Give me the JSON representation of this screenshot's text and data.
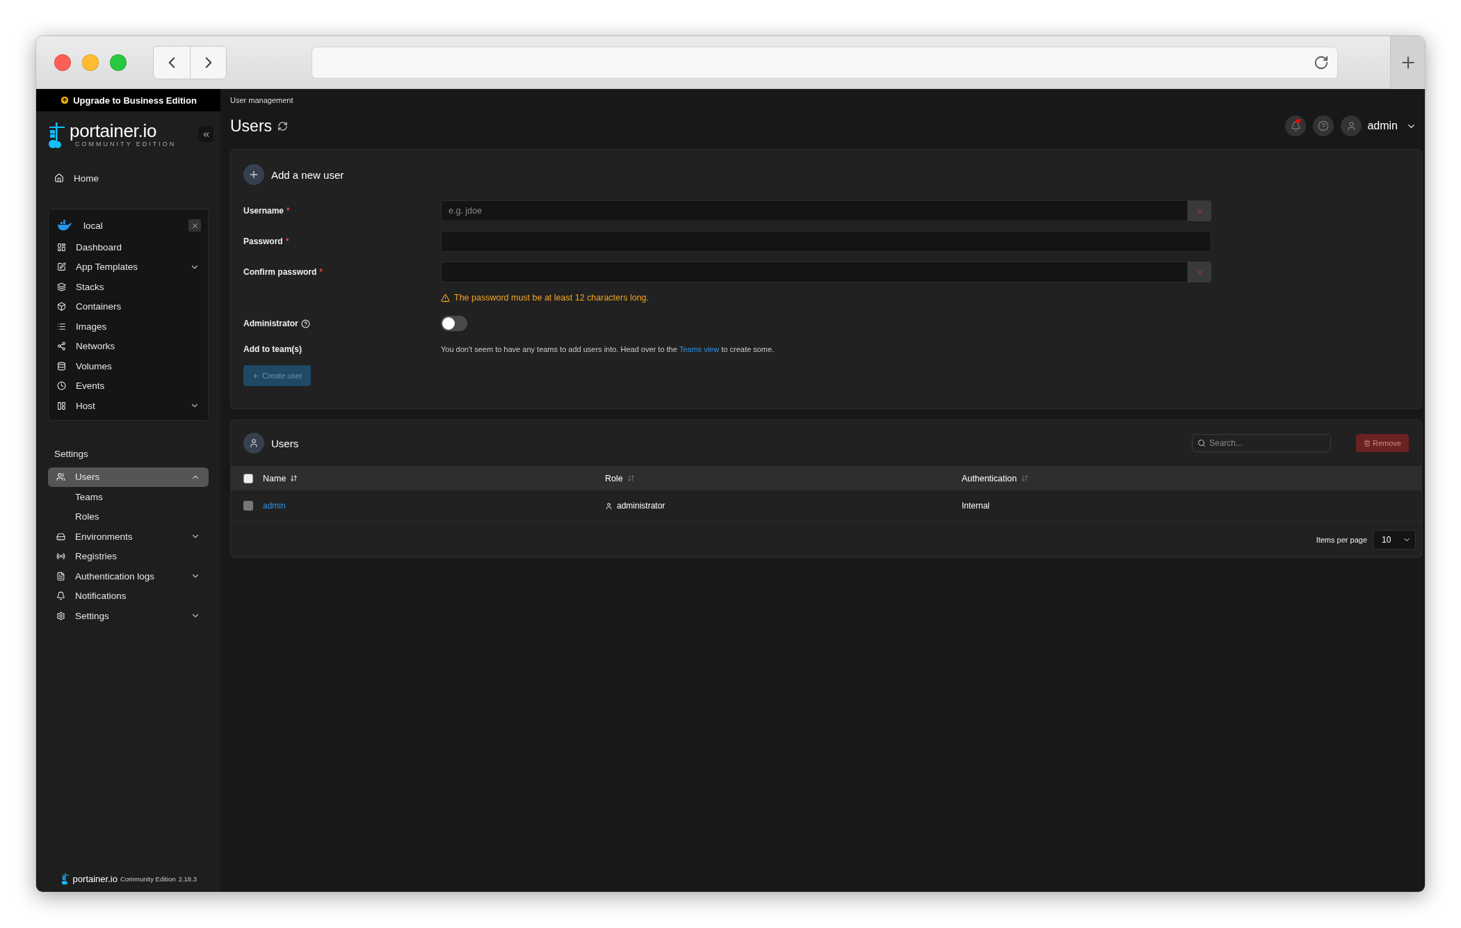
{
  "sidebar": {
    "upgrade_banner": "Upgrade to Business Edition",
    "logo": {
      "name": "portainer.io",
      "edition": "COMMUNITY EDITION"
    },
    "home": "Home",
    "environment": {
      "name": "local",
      "items": [
        {
          "label": "Dashboard"
        },
        {
          "label": "App Templates",
          "expanded": false
        },
        {
          "label": "Stacks"
        },
        {
          "label": "Containers"
        },
        {
          "label": "Images"
        },
        {
          "label": "Networks"
        },
        {
          "label": "Volumes"
        },
        {
          "label": "Events"
        },
        {
          "label": "Host",
          "expanded": false
        }
      ]
    },
    "settings_heading": "Settings",
    "settings_items": [
      {
        "label": "Users",
        "selected": true,
        "expanded": true,
        "children": [
          {
            "label": "Teams"
          },
          {
            "label": "Roles"
          }
        ]
      },
      {
        "label": "Environments",
        "selected": false,
        "expanded": false
      },
      {
        "label": "Registries",
        "selected": false
      },
      {
        "label": "Authentication logs",
        "selected": false,
        "expanded": false
      },
      {
        "label": "Notifications",
        "selected": false
      },
      {
        "label": "Settings",
        "selected": false,
        "expanded": false
      }
    ],
    "footer": {
      "brand": "portainer.io",
      "edition": "Community Edition",
      "version": "2.18.3"
    }
  },
  "header": {
    "breadcrumb": "User management",
    "title": "Users",
    "notifications": {
      "unread": true
    },
    "user": "admin"
  },
  "form": {
    "title": "Add a new user",
    "fields": [
      {
        "label": "Username",
        "required_mark": "*",
        "placeholder": "e.g. jdoe",
        "invalid": true
      },
      {
        "label": "Password",
        "required_mark": "*",
        "invalid": false
      },
      {
        "label": "Confirm password",
        "required_mark": "*",
        "invalid": true
      }
    ],
    "warning": "The password must be at least 12 characters long.",
    "administrator": {
      "label": "Administrator",
      "on": false
    },
    "teams": {
      "label": "Add to team(s)",
      "text_before": "You don't seem to have any teams to add users into. Head over to the",
      "link": "Teams view",
      "text_after": "to create some."
    },
    "create_button": {
      "label": "Create user",
      "disabled": true
    }
  },
  "table": {
    "title": "Users",
    "search": {
      "placeholder": "Search..."
    },
    "remove_button": {
      "label": "Remove",
      "disabled": true
    },
    "select_all": {
      "checked": false
    },
    "columns": [
      {
        "label": "Name",
        "sorted": true
      },
      {
        "label": "Role",
        "sorted": false
      },
      {
        "label": "Authentication",
        "sorted": false
      }
    ],
    "rows": [
      {
        "name": "admin",
        "role": "administrator",
        "authentication": "Internal",
        "selected": false
      }
    ],
    "items_per_page": {
      "label": "Items per page",
      "value": "10"
    }
  }
}
